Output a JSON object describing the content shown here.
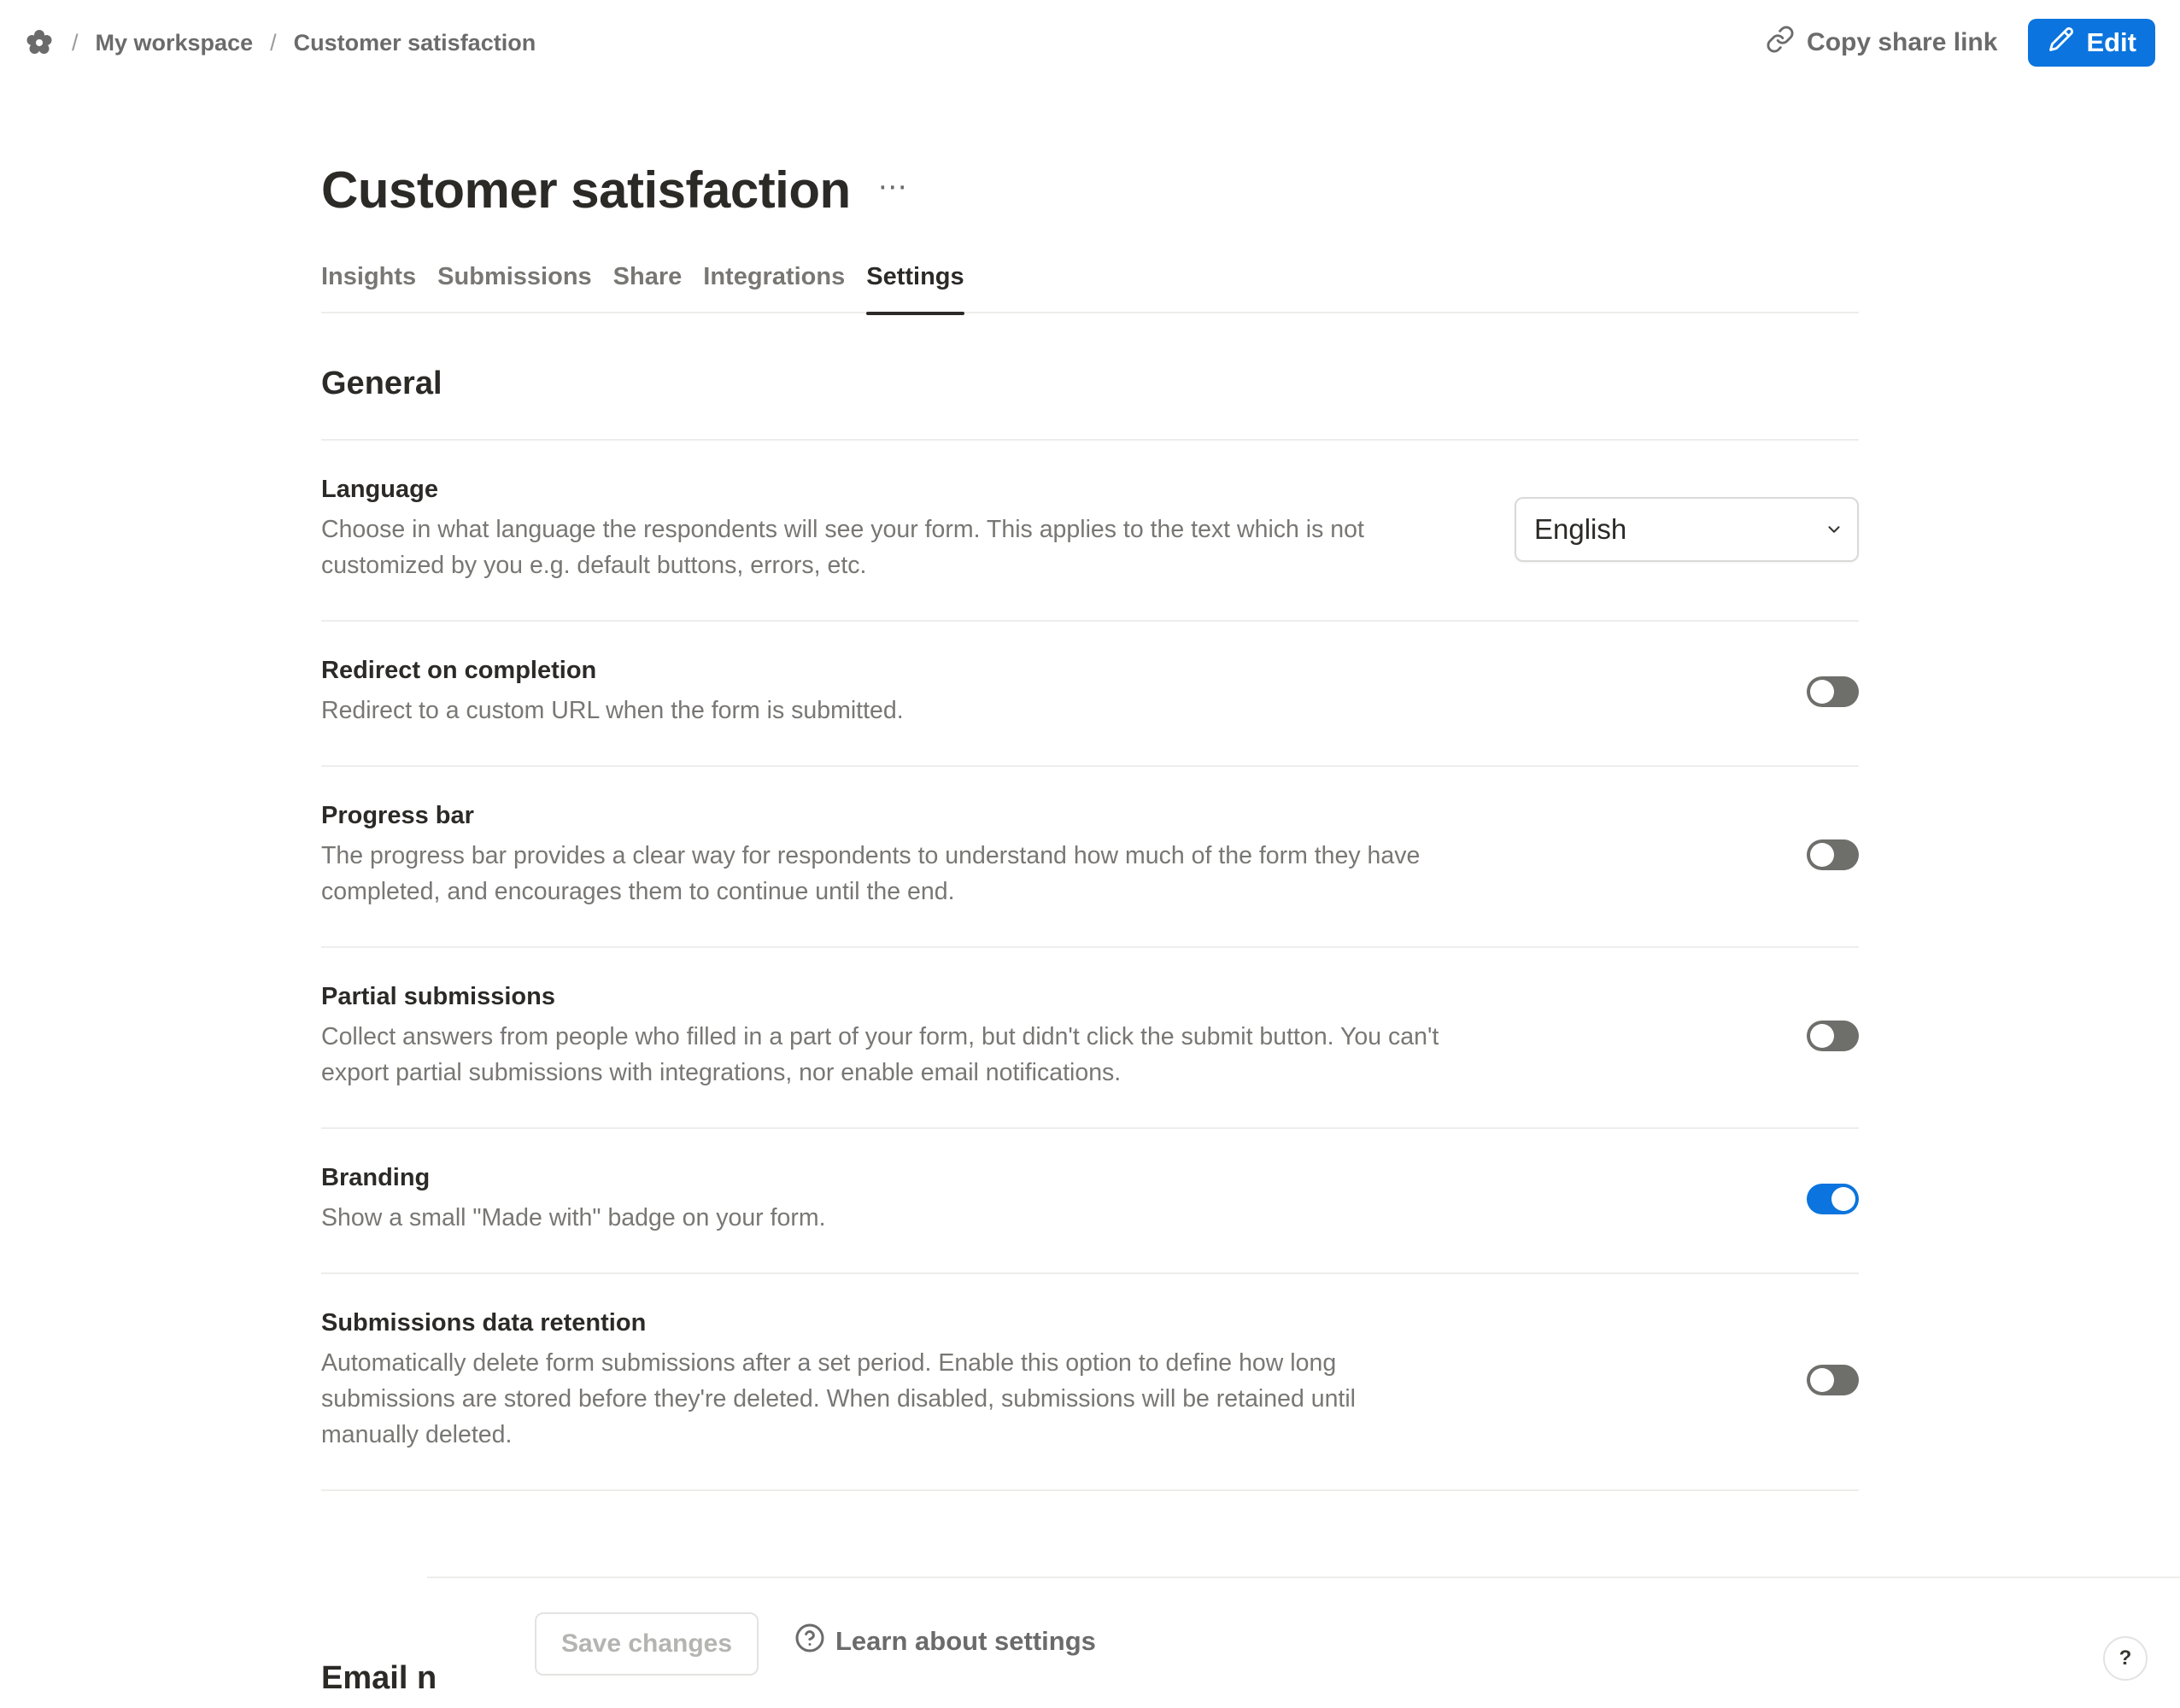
{
  "breadcrumb": {
    "logo_icon": "flower-logo-icon",
    "separator": "/",
    "workspace": "My workspace",
    "page": "Customer satisfaction"
  },
  "header": {
    "copy_share_link": "Copy share link",
    "edit": "Edit"
  },
  "form": {
    "title": "Customer satisfaction",
    "more_icon": "⋯"
  },
  "tabs": [
    {
      "label": "Insights",
      "active": false
    },
    {
      "label": "Submissions",
      "active": false
    },
    {
      "label": "Share",
      "active": false
    },
    {
      "label": "Integrations",
      "active": false
    },
    {
      "label": "Settings",
      "active": true
    }
  ],
  "general": {
    "title": "General",
    "settings": [
      {
        "label": "Language",
        "description": "Choose in what language the respondents will see your form. This applies to the text which is not customized by you e.g. default buttons, errors, etc.",
        "control": "select",
        "value": "English"
      },
      {
        "label": "Redirect on completion",
        "description": "Redirect to a custom URL when the form is submitted.",
        "control": "toggle",
        "enabled": false
      },
      {
        "label": "Progress bar",
        "description": "The progress bar provides a clear way for respondents to understand how much of the form they have completed, and encourages them to continue until the end.",
        "control": "toggle",
        "enabled": false
      },
      {
        "label": "Partial submissions",
        "description": "Collect answers from people who filled in a part of your form, but didn't click the submit button. You can't export partial submissions with integrations, nor enable email notifications.",
        "control": "toggle",
        "enabled": false
      },
      {
        "label": "Branding",
        "description": "Show a small \"Made with\" badge on your form.",
        "control": "toggle",
        "enabled": true
      },
      {
        "label": "Submissions data retention",
        "description": "Automatically delete form submissions after a set period. Enable this option to define how long submissions are stored before they're deleted. When disabled, submissions will be retained until manually deleted.",
        "control": "toggle",
        "enabled": false
      }
    ]
  },
  "next_section": {
    "title": "Email n"
  },
  "footer": {
    "save_changes": "Save changes",
    "learn_about_settings": "Learn about settings",
    "help": "?"
  },
  "colors": {
    "accent": "#0b74de",
    "toggle_off": "#6e6e6b",
    "text_primary": "#2b2a27",
    "text_secondary": "#787774"
  }
}
